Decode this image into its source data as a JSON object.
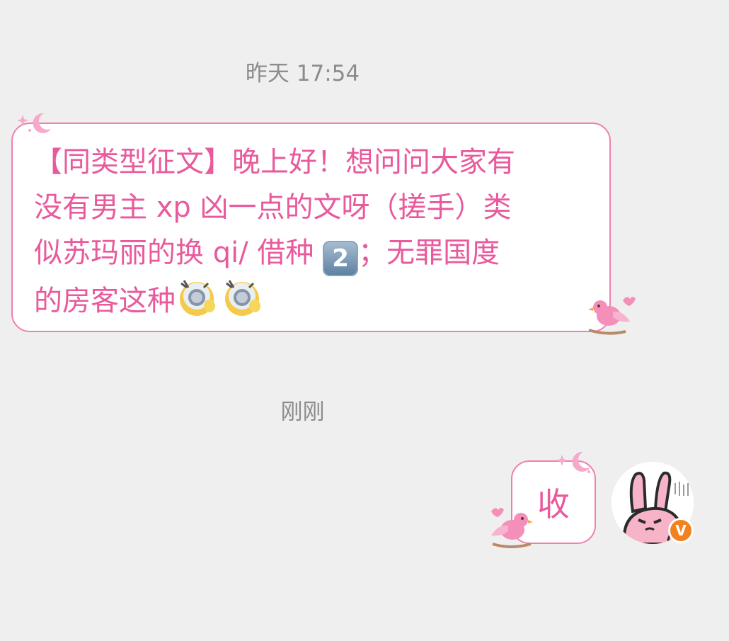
{
  "chat": {
    "timestamp_1": "昨天 17:54",
    "timestamp_2": "刚刚",
    "incoming": {
      "line1": "【同类型征文】晚上好！想问问大家有",
      "line2": "没有男主 xp 凶一点的文呀（搓手）类",
      "line3_a": "似苏玛丽的换 qi/ 借种 ",
      "keycap": "2",
      "line3_b": "；无罪国度",
      "line4": "的房客这种"
    },
    "outgoing": {
      "text": "收"
    },
    "avatar_badge": "V"
  },
  "colors": {
    "background": "#efefef",
    "bubble_border": "#f07fb0",
    "message_text": "#e85a9c",
    "timestamp": "#8c8c8c",
    "vip_badge": "#f2821f"
  },
  "icons": {
    "bubble_decoration_moon": "moon-star-icon",
    "bubble_decoration_bird": "pink-bird-icon",
    "emoji": "laughing-crying-face-icon",
    "avatar": "pink-rabbit-avatar"
  }
}
